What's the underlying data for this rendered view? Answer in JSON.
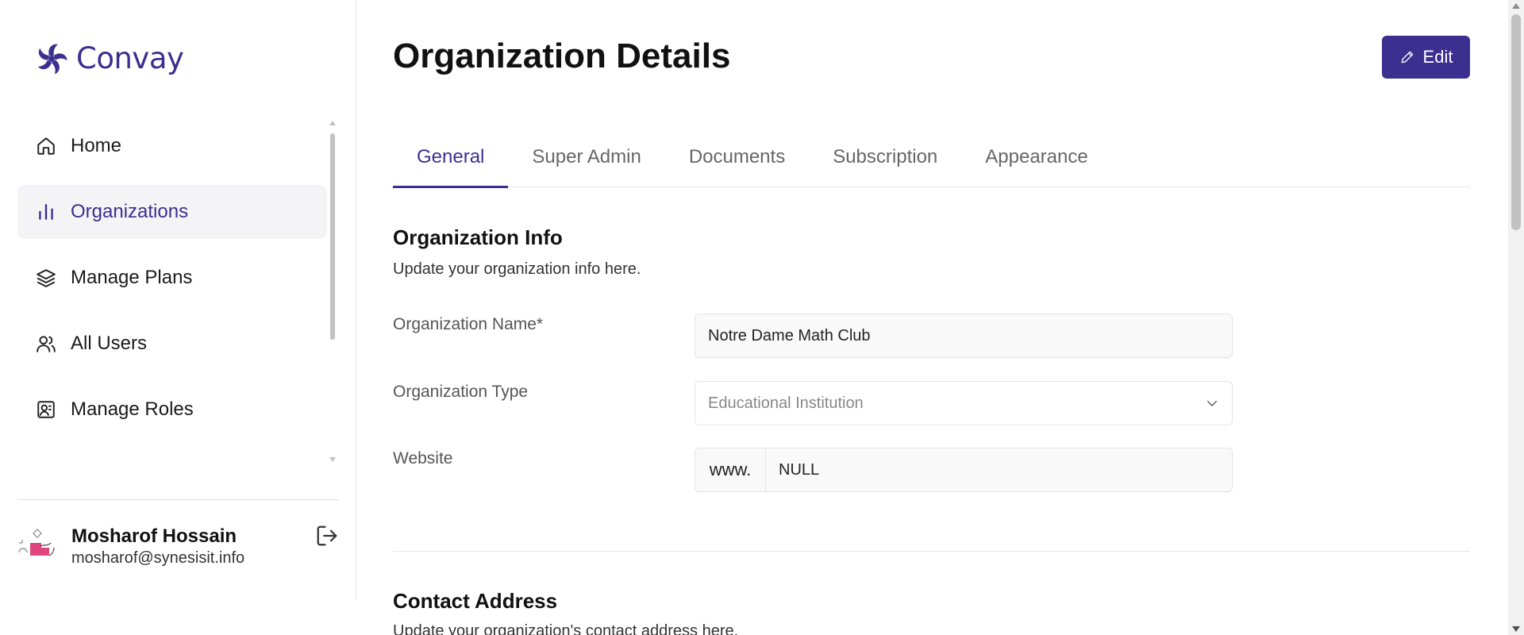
{
  "app": {
    "name": "Convay"
  },
  "sidebar": {
    "items": [
      {
        "label": "Home",
        "icon": "home-icon",
        "active": false
      },
      {
        "label": "Organizations",
        "icon": "bar-chart-icon",
        "active": true
      },
      {
        "label": "Manage Plans",
        "icon": "layers-icon",
        "active": false
      },
      {
        "label": "All Users",
        "icon": "users-icon",
        "active": false
      },
      {
        "label": "Manage Roles",
        "icon": "role-badge-icon",
        "active": false
      }
    ],
    "user": {
      "name": "Mosharof Hossain",
      "email": "mosharof@synesisit.info"
    }
  },
  "header": {
    "title": "Organization Details",
    "edit_label": "Edit"
  },
  "tabs": [
    {
      "label": "General",
      "active": true
    },
    {
      "label": "Super Admin",
      "active": false
    },
    {
      "label": "Documents",
      "active": false
    },
    {
      "label": "Subscription",
      "active": false
    },
    {
      "label": "Appearance",
      "active": false
    }
  ],
  "org_info": {
    "title": "Organization Info",
    "subtitle": "Update your organization info here.",
    "name_label": "Organization Name*",
    "name_value": "Notre Dame Math Club",
    "type_label": "Organization Type",
    "type_value": "Educational Institution",
    "website_label": "Website",
    "website_prefix": "www.",
    "website_value": "NULL"
  },
  "contact": {
    "title": "Contact Address",
    "subtitle": "Update your organization's contact address here."
  },
  "colors": {
    "accent": "#3b2f8f",
    "active_bg": "#f4f4f7",
    "border": "#e6e6ea"
  }
}
